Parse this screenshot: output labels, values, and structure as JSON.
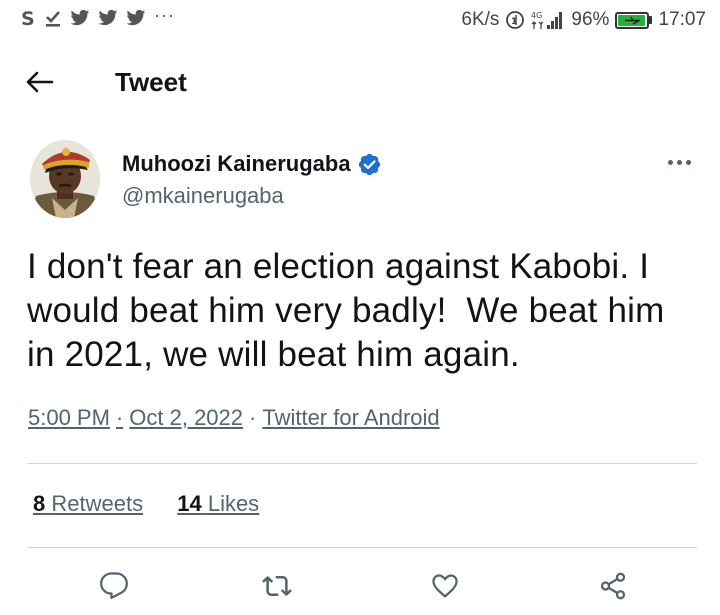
{
  "status_bar": {
    "notification_icons": [
      "s-app-icon",
      "download-done-icon",
      "twitter-icon",
      "twitter-icon",
      "twitter-icon"
    ],
    "more": "···",
    "network_speed": "6K/s",
    "network_type": "4G",
    "battery_percent": "96%",
    "battery_level": 0.96,
    "time": "17:07"
  },
  "header": {
    "back_icon": "arrow-left-icon",
    "title": "Tweet"
  },
  "tweet": {
    "author_name": "Muhoozi Kainerugaba",
    "verified": true,
    "handle": "@mkainerugaba",
    "text": "I don't fear an election against Kabobi. I would beat him very badly!  We beat him in 2021, we will beat him again.",
    "time": "5:00 PM",
    "date": "Oct 2, 2022",
    "source": "Twitter for Android",
    "retweets_count": "8",
    "retweets_label": "Retweets",
    "likes_count": "14",
    "likes_label": "Likes"
  },
  "actions": [
    "reply-icon",
    "retweet-icon",
    "like-icon",
    "share-icon"
  ],
  "colors": {
    "text": "#0f1419",
    "secondary": "#536471",
    "verified": "#1d9bf0",
    "divider": "#cfd9de",
    "battery": "#23b33a"
  }
}
